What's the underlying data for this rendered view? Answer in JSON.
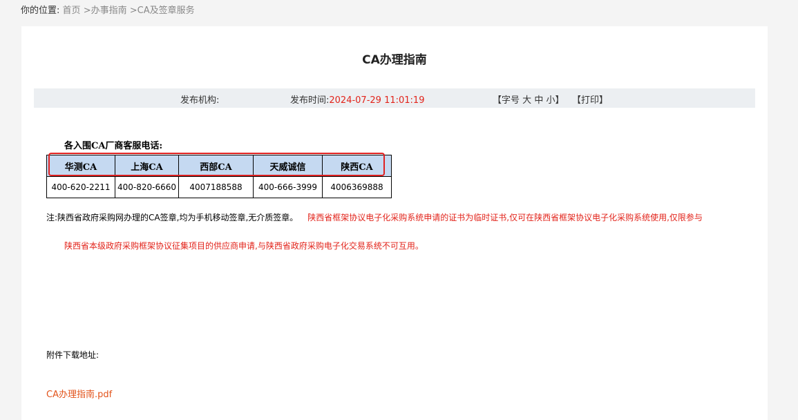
{
  "breadcrumb": {
    "label": "你的位置:",
    "items": [
      "首页",
      ">办事指南",
      ">CA及签章服务"
    ]
  },
  "article": {
    "title": "CA办理指南",
    "meta": {
      "publisher_label": "发布机构:",
      "time_label": "发布时间:",
      "time_value": "2024-07-29 11:01:19",
      "font_size_open": "【字号",
      "font_large": "大",
      "font_medium": "中",
      "font_small": "小",
      "font_size_close": "】",
      "print": "【打印】"
    },
    "vendors_heading": "各入围CA厂商客服电话:",
    "vendors_table": {
      "headers": [
        "华测CA",
        "上海CA",
        "西部CA",
        "天威诚信",
        "陕西CA"
      ],
      "phones": [
        "400-620-2211",
        "400-820-6660",
        "4007188588",
        "400-666-3999",
        "4006369888"
      ]
    },
    "note_black": "注:陕西省政府采购网办理的CA签章,均为手机移动签章,无介质签章。",
    "note_red_1": "陕西省框架协议电子化采购系统申请的证书为临时证书,仅可在陕西省框架协议电子化采购系统使用,仅限参与",
    "note_red_2": "陕西省本级政府采购框架协议征集项目的供应商申请,与陕西省政府采购电子化交易系统不可互用。",
    "attachment_label": "附件下载地址:",
    "attachment_link": "CA办理指南.pdf"
  },
  "colors": {
    "accent_red": "#e2231a",
    "header_blue": "#c5d9f1",
    "highlight_box": "#e02020"
  }
}
